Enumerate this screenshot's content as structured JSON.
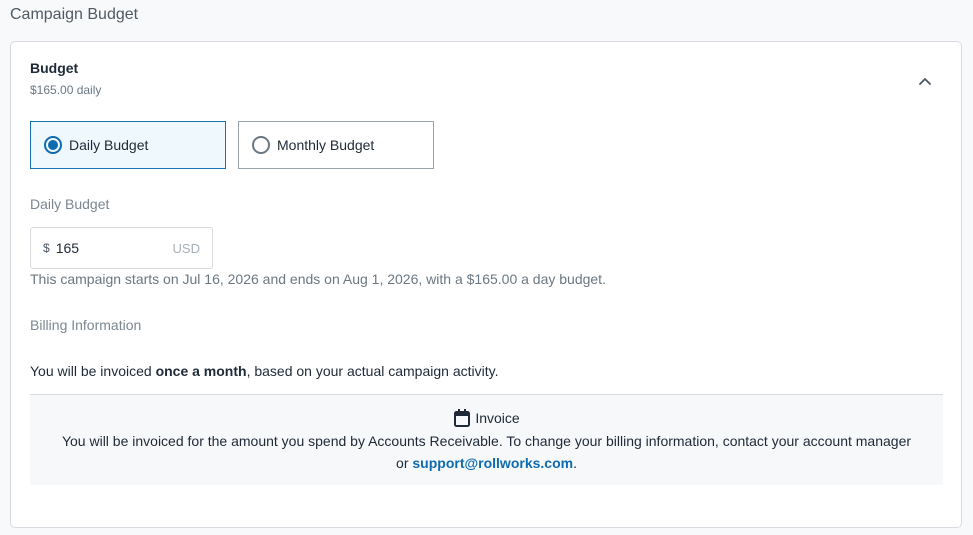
{
  "page_title": "Campaign Budget",
  "budget_section": {
    "title": "Budget",
    "summary": "$165.00 daily",
    "toggle_icon": "chevron-up-icon"
  },
  "budget_type": {
    "options": [
      {
        "label": "Daily Budget",
        "selected": true
      },
      {
        "label": "Monthly Budget",
        "selected": false
      }
    ]
  },
  "daily_budget": {
    "label": "Daily Budget",
    "currency_symbol": "$",
    "value": "165",
    "unit": "USD"
  },
  "campaign_note": "This campaign starts on Jul 16, 2026 and ends on Aug 1, 2026, with a $165.00 a day budget.",
  "billing": {
    "heading": "Billing Information",
    "frequency_prefix": "You will be invoiced ",
    "frequency_bold": "once a month",
    "frequency_suffix": ", based on your actual campaign activity.",
    "invoice": {
      "icon": "calendar-icon",
      "title": "Invoice",
      "text_prefix": "You will be invoiced for the amount you spend by Accounts Receivable. To change your billing information, contact your account manager or ",
      "link": "support@rollworks.com",
      "text_suffix": "."
    }
  },
  "colors": {
    "accent": "#0f6bb0",
    "selected_bg": "#eff8fc",
    "border": "#d7dbdf"
  }
}
